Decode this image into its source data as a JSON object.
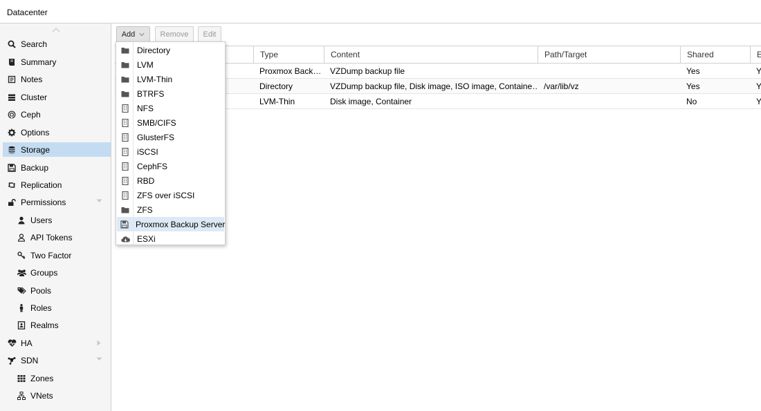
{
  "header": {
    "title": "Datacenter"
  },
  "sidebar": {
    "items": [
      {
        "label": "Search",
        "icon": "search-icon"
      },
      {
        "label": "Summary",
        "icon": "book-icon"
      },
      {
        "label": "Notes",
        "icon": "notes-icon"
      },
      {
        "label": "Cluster",
        "icon": "server-icon"
      },
      {
        "label": "Ceph",
        "icon": "ceph-icon"
      },
      {
        "label": "Options",
        "icon": "gear-icon"
      },
      {
        "label": "Storage",
        "icon": "database-icon",
        "active": true
      },
      {
        "label": "Backup",
        "icon": "floppy-icon"
      },
      {
        "label": "Replication",
        "icon": "retweet-icon"
      },
      {
        "label": "Permissions",
        "icon": "unlock-icon",
        "expanded": true
      },
      {
        "label": "Users",
        "icon": "user-icon",
        "sub": true
      },
      {
        "label": "API Tokens",
        "icon": "user-outline-icon",
        "sub": true
      },
      {
        "label": "Two Factor",
        "icon": "key-icon",
        "sub": true
      },
      {
        "label": "Groups",
        "icon": "users-icon",
        "sub": true
      },
      {
        "label": "Pools",
        "icon": "tags-icon",
        "sub": true
      },
      {
        "label": "Roles",
        "icon": "male-icon",
        "sub": true
      },
      {
        "label": "Realms",
        "icon": "address-book-icon",
        "sub": true
      },
      {
        "label": "HA",
        "icon": "heartbeat-icon",
        "collapsed": true
      },
      {
        "label": "SDN",
        "icon": "sdn-icon",
        "expanded": true
      },
      {
        "label": "Zones",
        "icon": "th-icon",
        "sub": true
      },
      {
        "label": "VNets",
        "icon": "sitemap-icon",
        "sub": true
      }
    ]
  },
  "toolbar": {
    "add_label": "Add",
    "remove_label": "Remove",
    "edit_label": "Edit"
  },
  "grid": {
    "columns": [
      "Type",
      "Content",
      "Path/Target",
      "Shared",
      "E"
    ],
    "rows": [
      {
        "type": "Proxmox Back…",
        "content": "VZDump backup file",
        "path": "",
        "shared": "Yes",
        "enabled": "Y"
      },
      {
        "type": "Directory",
        "content": "VZDump backup file, Disk image, ISO image, Containe…",
        "path": "/var/lib/vz",
        "shared": "Yes",
        "enabled": "Y"
      },
      {
        "type": "LVM-Thin",
        "content": "Disk image, Container",
        "path": "",
        "shared": "No",
        "enabled": "Y"
      }
    ]
  },
  "add_menu": {
    "items": [
      {
        "label": "Directory",
        "icon": "folder-icon"
      },
      {
        "label": "LVM",
        "icon": "folder-icon"
      },
      {
        "label": "LVM-Thin",
        "icon": "folder-icon"
      },
      {
        "label": "BTRFS",
        "icon": "folder-icon"
      },
      {
        "label": "NFS",
        "icon": "building-icon"
      },
      {
        "label": "SMB/CIFS",
        "icon": "building-icon"
      },
      {
        "label": "GlusterFS",
        "icon": "building-icon"
      },
      {
        "label": "iSCSI",
        "icon": "building-icon"
      },
      {
        "label": "CephFS",
        "icon": "building-icon"
      },
      {
        "label": "RBD",
        "icon": "building-icon"
      },
      {
        "label": "ZFS over iSCSI",
        "icon": "building-icon"
      },
      {
        "label": "ZFS",
        "icon": "folder-icon"
      },
      {
        "label": "Proxmox Backup Server",
        "icon": "floppy-icon",
        "highlighted": true
      },
      {
        "label": "ESXi",
        "icon": "cloud-icon"
      }
    ]
  },
  "colors": {
    "active_nav": "#c4dcf1",
    "menu_hover": "#ddeaf6",
    "sidebar_bg": "#f5f5f5"
  }
}
